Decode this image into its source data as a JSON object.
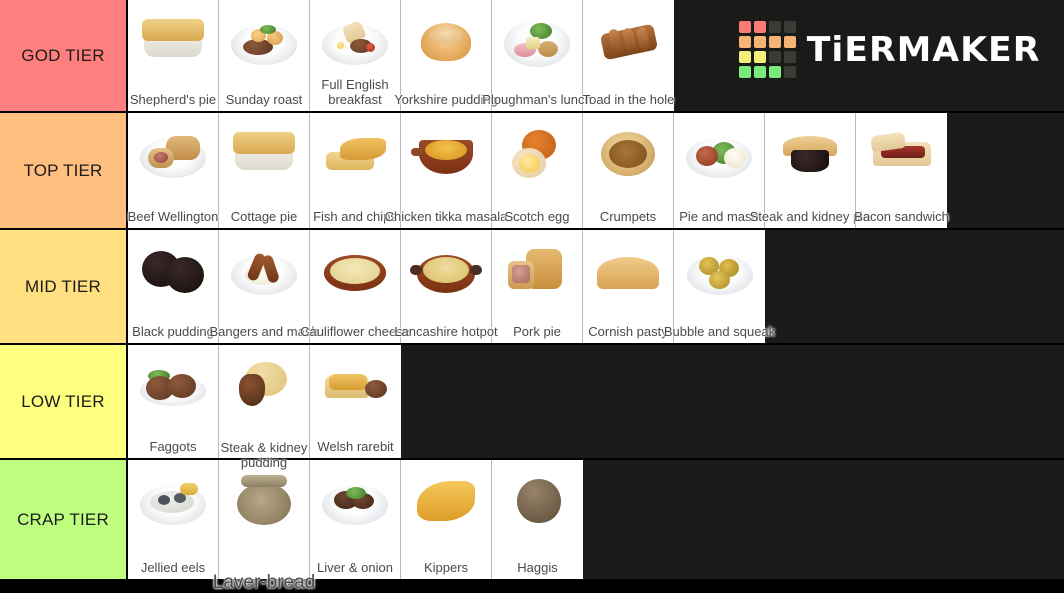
{
  "brand": {
    "name": "TiERMAKER",
    "logo_colors": {
      "red": "#f97a77",
      "orange": "#f7b373",
      "yellow": "#f3ef7a",
      "green": "#7bea7b",
      "empty": "#3b3b38"
    },
    "logo_grid": [
      [
        "red",
        "red",
        "empty",
        "empty"
      ],
      [
        "orange",
        "orange",
        "orange",
        "orange"
      ],
      [
        "yellow",
        "yellow",
        "empty",
        "empty"
      ],
      [
        "green",
        "green",
        "green",
        "empty"
      ]
    ]
  },
  "background_color": "#1a1a18",
  "tiers": [
    {
      "label": "GOD TIER",
      "color": "#ff7f7f",
      "items": [
        {
          "name": "Shepherd's pie",
          "shape": "shepherds-pie"
        },
        {
          "name": "Sunday roast",
          "shape": "sunday-roast"
        },
        {
          "name": "Full English breakfast",
          "shape": "full-english"
        },
        {
          "name": "Yorkshire pudding",
          "shape": "yorkshire-pudding"
        },
        {
          "name": "Ploughman's lunch",
          "shape": "ploughmans-lunch"
        },
        {
          "name": "Toad in the hole",
          "shape": "toad-in-the-hole"
        }
      ]
    },
    {
      "label": "TOP TIER",
      "color": "#ffbf7f",
      "items": [
        {
          "name": "Beef Wellington",
          "shape": "beef-wellington"
        },
        {
          "name": "Cottage pie",
          "shape": "cottage-pie"
        },
        {
          "name": "Fish and chips",
          "shape": "fish-and-chips"
        },
        {
          "name": "Chicken tikka masala",
          "shape": "chicken-tikka-masala"
        },
        {
          "name": "Scotch egg",
          "shape": "scotch-egg"
        },
        {
          "name": "Crumpets",
          "shape": "crumpets"
        },
        {
          "name": "Pie and mash",
          "shape": "pie-and-mash"
        },
        {
          "name": "Steak and kidney pie",
          "shape": "steak-kidney-pie"
        },
        {
          "name": "Bacon sandwich",
          "shape": "bacon-sandwich"
        }
      ]
    },
    {
      "label": "MID TIER",
      "color": "#ffdf7f",
      "items": [
        {
          "name": "Black pudding",
          "shape": "black-pudding"
        },
        {
          "name": "Bangers and mash",
          "shape": "bangers-and-mash"
        },
        {
          "name": "Cauliflower cheese",
          "shape": "cauliflower-cheese"
        },
        {
          "name": "Lancashire hotpot",
          "shape": "lancashire-hotpot"
        },
        {
          "name": "Pork pie",
          "shape": "pork-pie"
        },
        {
          "name": "Cornish pasty",
          "shape": "cornish-pasty"
        },
        {
          "name": "Bubble and squeak",
          "shape": "bubble-and-squeak"
        }
      ]
    },
    {
      "label": "LOW TIER",
      "color": "#ffff7f",
      "items": [
        {
          "name": "Faggots",
          "shape": "faggots"
        },
        {
          "name": "Steak & kidney pudding",
          "shape": "steak-kidney-pudding"
        },
        {
          "name": "Welsh rarebit",
          "shape": "welsh-rarebit"
        }
      ]
    },
    {
      "label": "CRAP TIER",
      "color": "#bfff7f",
      "items": [
        {
          "name": "Jellied eels",
          "shape": "jellied-eels"
        },
        {
          "name": "Laver-bread",
          "shape": "laverbread"
        },
        {
          "name": "Liver & onion",
          "shape": "liver-and-onion"
        },
        {
          "name": "Kippers",
          "shape": "kippers"
        },
        {
          "name": "Haggis",
          "shape": "haggis"
        }
      ]
    }
  ]
}
